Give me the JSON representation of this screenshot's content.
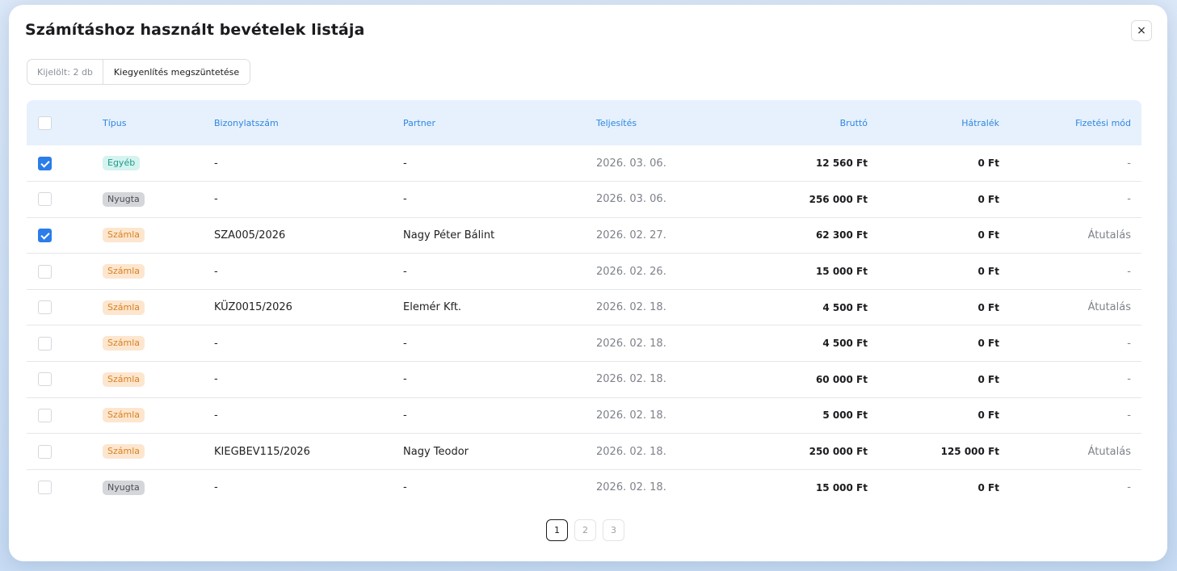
{
  "modal": {
    "title": "Számításhoz használt bevételek listája",
    "close_label": "×"
  },
  "toolbar": {
    "selected_label": "Kijelölt: 2 db",
    "action_label": "Kiegyenlítés megszüntetése"
  },
  "table": {
    "headers": {
      "type": "Típus",
      "doc": "Bizonylatszám",
      "partner": "Partner",
      "date": "Teljesítés",
      "gross": "Bruttó",
      "due": "Hátralék",
      "pay": "Fizetési mód"
    },
    "rows": [
      {
        "checked": true,
        "type": "Egyéb",
        "type_color": "teal",
        "doc": "-",
        "partner": "-",
        "date": "2026. 03. 06.",
        "gross": "12 560 Ft",
        "due": "0 Ft",
        "pay": "-"
      },
      {
        "checked": false,
        "type": "Nyugta",
        "type_color": "gray",
        "doc": "-",
        "partner": "-",
        "date": "2026. 03. 06.",
        "gross": "256 000 Ft",
        "due": "0 Ft",
        "pay": "-"
      },
      {
        "checked": true,
        "type": "Számla",
        "type_color": "orange",
        "doc": "SZA005/2026",
        "partner": "Nagy Péter Bálint",
        "date": "2026. 02. 27.",
        "gross": "62 300 Ft",
        "due": "0 Ft",
        "pay": "Átutalás"
      },
      {
        "checked": false,
        "type": "Számla",
        "type_color": "orange",
        "doc": "-",
        "partner": "-",
        "date": "2026. 02. 26.",
        "gross": "15 000 Ft",
        "due": "0 Ft",
        "pay": "-"
      },
      {
        "checked": false,
        "type": "Számla",
        "type_color": "orange",
        "doc": "KÜZ0015/2026",
        "partner": "Elemér Kft.",
        "date": "2026. 02. 18.",
        "gross": "4 500 Ft",
        "due": "0 Ft",
        "pay": "Átutalás"
      },
      {
        "checked": false,
        "type": "Számla",
        "type_color": "orange",
        "doc": "-",
        "partner": "-",
        "date": "2026. 02. 18.",
        "gross": "4 500 Ft",
        "due": "0 Ft",
        "pay": "-"
      },
      {
        "checked": false,
        "type": "Számla",
        "type_color": "orange",
        "doc": "-",
        "partner": "-",
        "date": "2026. 02. 18.",
        "gross": "60 000 Ft",
        "due": "0 Ft",
        "pay": "-"
      },
      {
        "checked": false,
        "type": "Számla",
        "type_color": "orange",
        "doc": "-",
        "partner": "-",
        "date": "2026. 02. 18.",
        "gross": "5 000 Ft",
        "due": "0 Ft",
        "pay": "-"
      },
      {
        "checked": false,
        "type": "Számla",
        "type_color": "orange",
        "doc": "KIEGBEV115/2026",
        "partner": "Nagy Teodor",
        "date": "2026. 02. 18.",
        "gross": "250 000 Ft",
        "due": "125 000 Ft",
        "pay": "Átutalás"
      },
      {
        "checked": false,
        "type": "Nyugta",
        "type_color": "gray",
        "doc": "-",
        "partner": "-",
        "date": "2026. 02. 18.",
        "gross": "15 000 Ft",
        "due": "0 Ft",
        "pay": "-"
      }
    ]
  },
  "pagination": {
    "pages": [
      "1",
      "2",
      "3"
    ],
    "current": "1"
  }
}
